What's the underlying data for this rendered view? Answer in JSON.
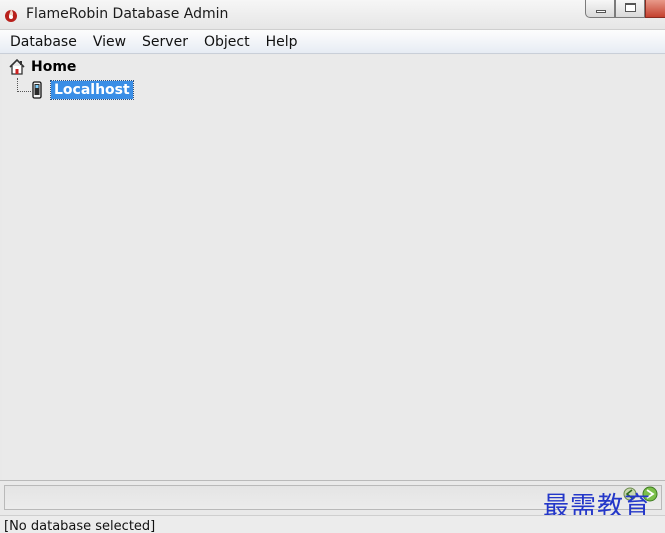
{
  "window": {
    "title": "FlameRobin Database Admin",
    "app_icon": "flamerobin-icon",
    "controls": [
      "minimize-icon",
      "maximize-icon",
      "close-icon"
    ]
  },
  "menubar": {
    "items": [
      "Database",
      "View",
      "Server",
      "Object",
      "Help"
    ]
  },
  "tree": {
    "root": {
      "label": "Home",
      "icon": "home-icon"
    },
    "children": [
      {
        "label": "Localhost",
        "icon": "server-icon",
        "selected": true
      }
    ]
  },
  "bottom": {
    "watermark": "最需教育",
    "nav_icon": "arrow-buttons-icon"
  },
  "statusbar": {
    "text": "[No database selected]"
  },
  "colors": {
    "selection": "#3a8ee6",
    "close_button": "#c4412f",
    "watermark": "#2437c9"
  }
}
